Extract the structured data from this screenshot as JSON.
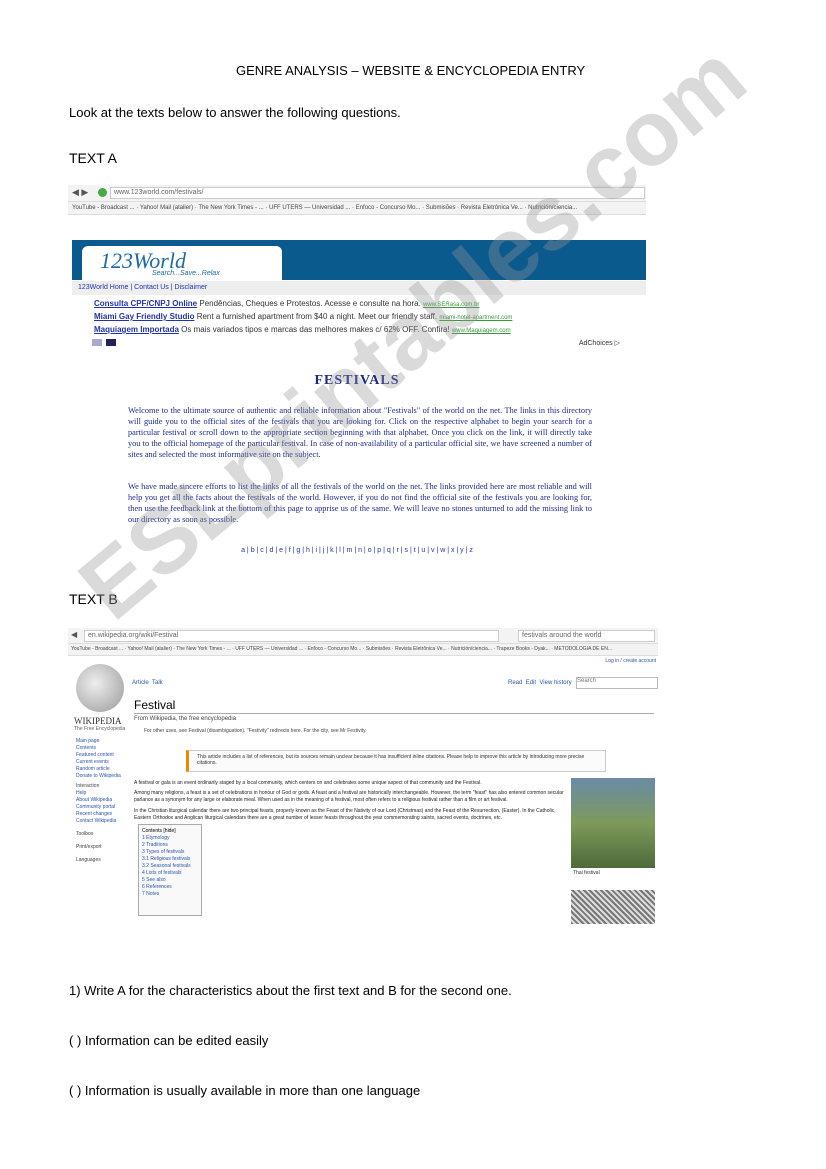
{
  "title": "GENRE ANALYSIS – WEBSITE & ENCYCLOPEDIA ENTRY",
  "instruction": "Look at the texts below to answer the following questions.",
  "text_a": {
    "heading": "TEXT A",
    "url": "www.123world.com/festivals/",
    "bookmarks": [
      "YouTube - Broadcast ...",
      "Yahoo! Mail (atalier)",
      "The New York Times - ...",
      "UFF UTERS — Universidad ...",
      "Enfoco - Concurso Mo...",
      "Submisões",
      "Revista Eletrônica Ve...",
      "Nutrición/ciencia..."
    ],
    "logo": "123World",
    "logo_tagline": "Search...Save...Relax",
    "nav": [
      "123World Home",
      "Contact Us",
      "Disclaimer"
    ],
    "ads": [
      {
        "title": "Consulta CPF/CNPJ Online",
        "text": "Pendências, Cheques e Protestos. Acesse e consulte na hora.",
        "link": "www.SERasa.com.br"
      },
      {
        "title": "Miami Gay Friendly Studio",
        "text": "Rent a furnished apartment from $40 a night. Meet our friendly staff.",
        "link": "miami-hotel-apartment.com"
      },
      {
        "title": "Maquiagem Importada",
        "text": "Os mais variados tipos e marcas das melhores makes c/ 62% OFF. Confira!",
        "link": "www.Maquiagem.com"
      }
    ],
    "adchoices": "AdChoices ▷",
    "page_title": "FESTIVALS",
    "para1": "Welcome to the ultimate source of authentic and reliable information about \"Festivals\" of the world on the net. The links in this directory will guide you to the official sites of the festivals that you are looking for. Click on the respective alphabet to begin your search for a particular festival or scroll down to the appropriate section beginning with that alphabet. Once you click on the link, it will directly take you to the official homepage of the particular festival. In case of non-availability of a particular official site, we have screened a number of sites and selected the most informative site on the subject.",
    "para2": "We have made sincere efforts to list the links of all the festivals of the world on the net. The links provided here are most reliable and will help you get all the facts about the festivals of the world. However, if you do not find the official site of the festivals you are looking for, then use the feedback link at the bottom of this page to apprise us of the same. We will leave no stones unturned to add the missing link to our directory as soon as possible.",
    "alphabet": "a | b | c | d | e | f | g | h | i | j | k | l | m | n | o | p | q | r | s | t | u | v | w | x | y | z"
  },
  "text_b": {
    "heading": "TEXT B",
    "url": "en.wikipedia.org/wiki/Festival",
    "search_box": "festivals around the world",
    "bookmarks": [
      "YouTube - Broadcast ...",
      "Yahoo! Mail (atalier)",
      "The New York Times - ...",
      "UFF UTERS — Universidad ...",
      "Enfoco - Concurso Mo...",
      "Submisões",
      "Revista Eletrônica Ve...",
      "Nutrición/ciencia...",
      "Trapeze Books - Dyak...",
      "METODOLOGIA DE EN..."
    ],
    "login": "Log in / create account",
    "logo": "WIKIPEDIA",
    "logo_tagline": "The Free Encyclopedia",
    "sidebar": [
      "Main page",
      "Contents",
      "Featured content",
      "Current events",
      "Random article",
      "Donate to Wikipedia",
      "Interaction",
      "Help",
      "About Wikipedia",
      "Community portal",
      "Recent changes",
      "Contact Wikipedia",
      "Toolbox",
      "Print/export",
      "Languages"
    ],
    "tabs": [
      "Article",
      "Talk"
    ],
    "actions": [
      "Read",
      "Edit",
      "View history"
    ],
    "search_placeholder": "Search",
    "article_title": "Festival",
    "from": "From Wikipedia, the free encyclopedia",
    "hatnote": "For other uses, see Festival (disambiguation). \"Festivity\" redirects here. For the city, see Mr Festivity.",
    "notice": "This article includes a list of references, but its sources remain unclear because it has insufficient inline citations. Please help to improve this article by introducing more precise citations.",
    "body1": "A festival or gala is an event ordinarily staged by a local community, which centers on and celebrates some unique aspect of that community and the Festival.",
    "body2": "Among many religions, a feast is a set of celebrations in honour of God or gods. A feast and a festival are historically interchangeable. However, the term \"feast\" has also entered common secular parlance as a synonym for any large or elaborate meal. When used as in the meaning of a festival, most often refers to a religious festival rather than a film or art festival.",
    "body3": "In the Christian liturgical calendar there are two principal feasts, properly known as the Feast of the Nativity of our Lord (Christmas) and the Feast of the Resurrection, (Easter). In the Catholic, Eastern Orthodox and Anglican liturgical calendars there are a great number of lesser feasts throughout the year commemorating saints, sacred events, doctrines, etc.",
    "toc_title": "Contents [hide]",
    "toc": [
      "1 Etymology",
      "2 Traditions",
      "3 Types of festivals",
      "3.1 Religious festivals",
      "3.2 Seasonal festivals",
      "4 Lists of festivals",
      "5 See also",
      "6 References",
      "7 Notes"
    ],
    "image_caption": "Thai festival"
  },
  "questions": {
    "q1": "1)     Write A for the characteristics about the first text and B for the second one.",
    "items": [
      "(    ) Information can be edited easily",
      "(    ) Information is usually available in more than one language"
    ]
  },
  "watermark": "ESLprintables.com"
}
